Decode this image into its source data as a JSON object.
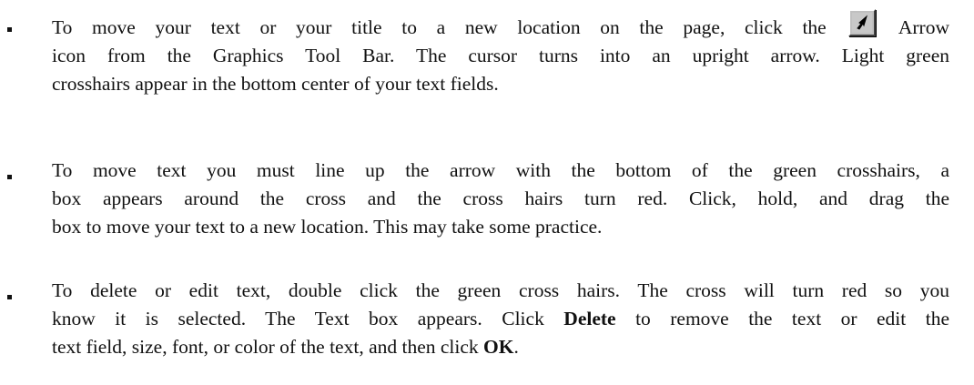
{
  "bullets": [
    {
      "line1_before_icon": "To move your text or your title to a new location on the page, click the",
      "line1_after_icon": "Arrow",
      "line2": "icon from the Graphics Tool Bar. The cursor turns into an upright arrow. Light green",
      "line3": "crosshairs appear in the bottom center of your text fields."
    },
    {
      "line1": "To move text you must line up the arrow with the bottom of the green crosshairs, a",
      "line2": "box appears around the cross and the cross hairs turn red. Click, hold, and drag the",
      "line3": "box to move your text to a new location. This may take some practice."
    },
    {
      "line1": "To delete or edit text, double click the green cross hairs. The cross will turn red so you",
      "line2": "know it is selected. The Text box appears. Click",
      "line2_bold": "Delete",
      "line2_after": "to remove the text or edit the",
      "line3": "text field, size, font, or color of the text, and then click",
      "line3_bold": "OK",
      "line3_end": "."
    }
  ],
  "icons": {
    "arrow_tool": "arrow-tool-icon"
  }
}
